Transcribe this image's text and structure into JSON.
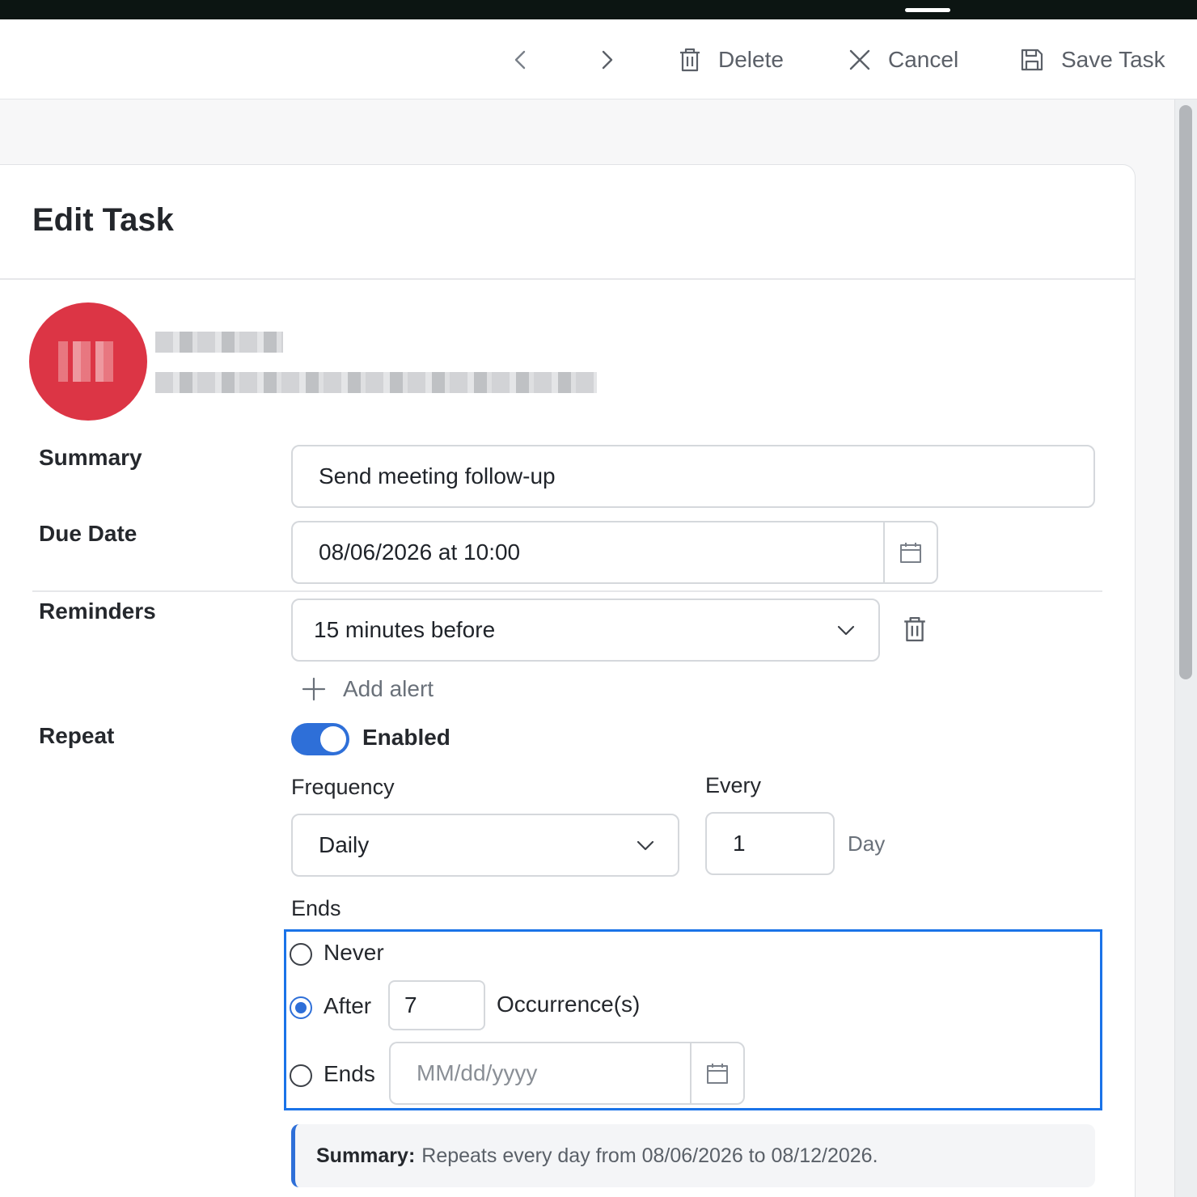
{
  "toolbar": {
    "delete_label": "Delete",
    "cancel_label": "Cancel",
    "save_label": "Save Task"
  },
  "card": {
    "title": "Edit Task"
  },
  "user": {
    "name": "[redacted]",
    "email": "[redacted]"
  },
  "form": {
    "summary": {
      "label": "Summary",
      "value": "Send meeting follow-up"
    },
    "due_date": {
      "label": "Due Date",
      "value": "08/06/2026 at 10:00"
    },
    "reminders": {
      "label": "Reminders",
      "selected": "15 minutes before",
      "add_label": "Add alert"
    },
    "repeat": {
      "label": "Repeat",
      "enabled": true,
      "toggle_label": "Enabled",
      "frequency_label": "Frequency",
      "frequency_value": "Daily",
      "every_label": "Every",
      "every_value": "1",
      "every_unit": "Day",
      "ends_label": "Ends",
      "options": {
        "never": "Never",
        "after": "After",
        "after_value": "7",
        "after_unit": "Occurrence(s)",
        "on_date": "Ends",
        "on_date_placeholder": "MM/dd/yyyy"
      },
      "selected_end": "after"
    }
  },
  "summary_note": {
    "prefix": "Summary:",
    "text": "Repeats every day from 08/06/2026 to 08/12/2026."
  },
  "colors": {
    "accent": "#2e6fd8",
    "focus_outline": "#1a73e8",
    "avatar": "#dc3545"
  }
}
